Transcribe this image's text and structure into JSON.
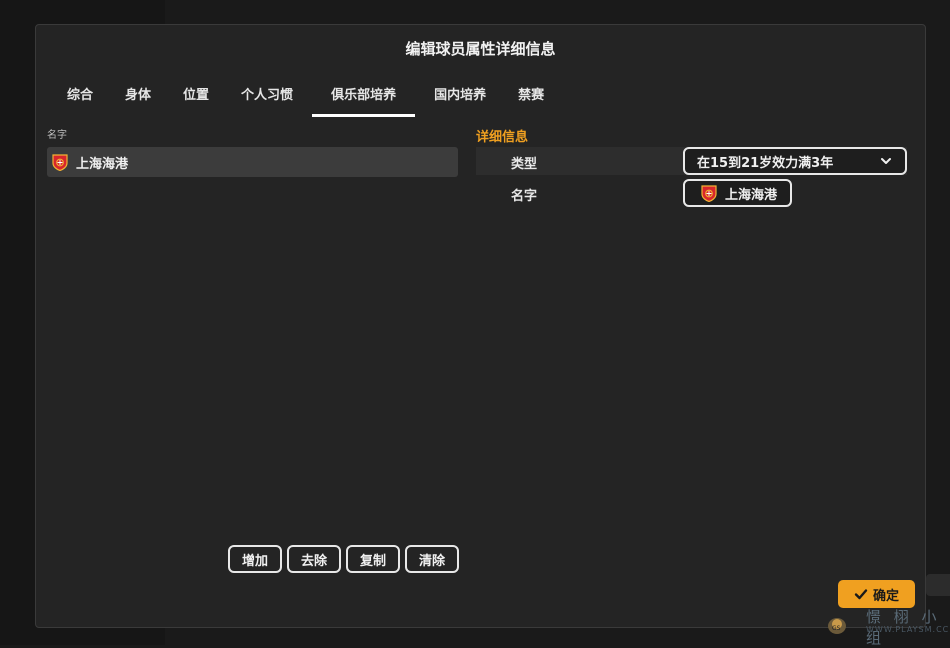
{
  "dialog": {
    "title": "编辑球员属性详细信息"
  },
  "tabs": [
    {
      "label": "综合",
      "active": false
    },
    {
      "label": "身体",
      "active": false
    },
    {
      "label": "位置",
      "active": false
    },
    {
      "label": "个人习惯",
      "active": false
    },
    {
      "label": "俱乐部培养",
      "active": true
    },
    {
      "label": "国内培养",
      "active": false
    },
    {
      "label": "禁赛",
      "active": false
    }
  ],
  "left_panel": {
    "header": "名字",
    "items": [
      {
        "name": "上海海港",
        "icon": "club-crest-icon",
        "selected": true
      }
    ]
  },
  "details": {
    "header": "详细信息",
    "type_label": "类型",
    "type_value": "在15到21岁效力满3年",
    "name_label": "名字",
    "name_value": "上海海港",
    "name_icon": "club-crest-icon"
  },
  "actions": {
    "add": "增加",
    "remove": "去除",
    "copy": "复制",
    "clear": "清除"
  },
  "confirm": {
    "label": "确定",
    "icon": "check-icon"
  },
  "watermark": {
    "chars": "憬 栩 小 组",
    "url": "WWW.PLAYSM.CC"
  },
  "colors": {
    "accent": "#f0a020",
    "dialog_bg": "#242424",
    "selected_row": "#3c3c3c",
    "crest_red": "#d8262c",
    "crest_gold": "#f2b233"
  }
}
